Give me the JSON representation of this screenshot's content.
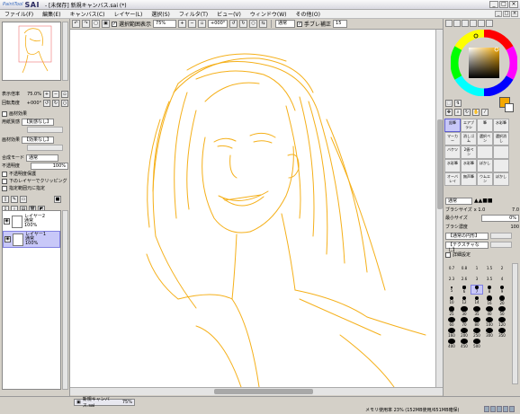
{
  "window": {
    "app_brand": "SAI",
    "app_prefix": "PaintTool",
    "title": "- [未保存] 新規キャンバス.sai (*)",
    "controls": [
      "_",
      "□",
      "×"
    ]
  },
  "menu": [
    "ファイル(F)",
    "編集(E)",
    "キャンバス(C)",
    "レイヤー(L)",
    "選択(S)",
    "フィルタ(T)",
    "ビュー(V)",
    "ウィンドウ(W)",
    "その他(O)"
  ],
  "toolbar": {
    "show_selection_label": "選択範囲表示",
    "zoom": "75%",
    "rotation": "+000°",
    "mode": "通常",
    "stabilizer_label": "手ブレ補正",
    "stabilizer_value": "15"
  },
  "navigator": {
    "zoom_label": "表示倍率",
    "zoom_value": "75.0%",
    "rotation_label": "回転角度",
    "rotation_value": "+000°"
  },
  "paper_texture": {
    "header": "画材効果",
    "texture_label": "用紙質感",
    "texture_value": "【質感なし】",
    "effect_label": "画材効果",
    "effect_value": "【効果なし】"
  },
  "layer_props": {
    "blend_label": "合成モード",
    "blend_value": "通常",
    "opacity_label": "不透明度",
    "opacity_value": "100%",
    "protect_opacity": "不透明度保護",
    "clip": "下のレイヤーでクリッピング",
    "select_source": "指定範囲元に指定"
  },
  "layers": [
    {
      "name": "レイヤー2",
      "mode": "通常",
      "opacity": "100%",
      "selected": false
    },
    {
      "name": "レイヤー1",
      "mode": "通常",
      "opacity": "100%",
      "selected": true
    }
  ],
  "tools": [
    {
      "label": "鉛筆",
      "selected": true
    },
    {
      "label": "エアブラシ",
      "selected": false
    },
    {
      "label": "筆",
      "selected": false
    },
    {
      "label": "水彩筆",
      "selected": false
    },
    {
      "label": "マーカー",
      "selected": false
    },
    {
      "label": "消しゴム",
      "selected": false
    },
    {
      "label": "選択ペン",
      "selected": false
    },
    {
      "label": "選択消し",
      "selected": false
    },
    {
      "label": "バケツ",
      "selected": false
    },
    {
      "label": "2値ペン",
      "selected": false
    },
    {
      "label": "",
      "selected": false
    },
    {
      "label": "",
      "selected": false
    },
    {
      "label": "水彩筆",
      "selected": false
    },
    {
      "label": "水彩筆",
      "selected": false
    },
    {
      "label": "ぼかし",
      "selected": false
    },
    {
      "label": "",
      "selected": false
    },
    {
      "label": "オーバレイ",
      "selected": false
    },
    {
      "label": "無声筆",
      "selected": false
    },
    {
      "label": "ウムエン",
      "selected": false
    },
    {
      "label": "ぼかし",
      "selected": false
    }
  ],
  "brush": {
    "mode": "通常",
    "size_label": "ブラシサイズ",
    "size_mult": "x 1.0",
    "size_value": "7.0",
    "min_size_label": "最小サイズ",
    "min_size_value": "0%",
    "density_label": "ブラシ濃度",
    "density_value": "100",
    "shape_value": "【通常の円形】",
    "texture_value": "【テクスチャなし】",
    "detail_label": "詳細設定"
  },
  "brush_sizes": [
    "0.7",
    "0.8",
    "1",
    "1.5",
    "2",
    "2.3",
    "2.6",
    "3",
    "3.5",
    "4",
    "5",
    "6",
    "7",
    "8",
    "9",
    "10",
    "12",
    "14",
    "16",
    "20",
    "25",
    "30",
    "35",
    "40",
    "50",
    "60",
    "70",
    "80",
    "100",
    "120",
    "160",
    "200",
    "250",
    "300",
    "350",
    "400",
    "450",
    "500"
  ],
  "status": {
    "doc_name": "新規キャンバス.sai",
    "doc_zoom": "75%",
    "memory": "メモリ使用率 23% (152MB使用/651MB確保)"
  },
  "colors": {
    "accent": "#f4a800",
    "selection": "#c8c8f8",
    "sketch": "#f5b01a"
  }
}
